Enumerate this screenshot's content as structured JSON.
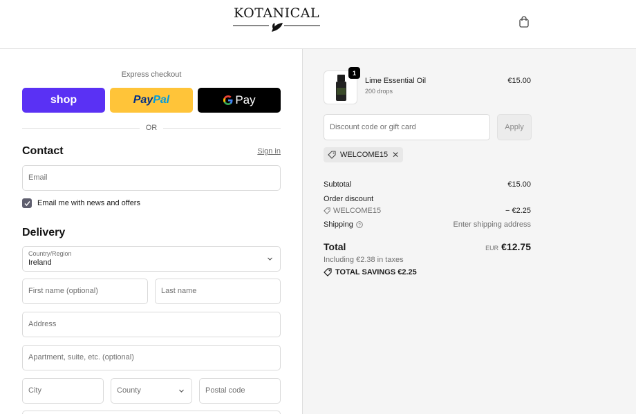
{
  "header": {
    "logo_text": "KOTANICAL",
    "cart_icon": "shopping-bag-icon"
  },
  "express": {
    "title": "Express checkout",
    "shop_label": "shop",
    "paypal_label_a": "Pay",
    "paypal_label_b": "Pal",
    "gpay_label": "Pay",
    "or_label": "OR"
  },
  "contact": {
    "title": "Contact",
    "signin_label": "Sign in",
    "email_placeholder": "Email",
    "news_checkbox_label": "Email me with news and offers",
    "news_checked": true
  },
  "delivery": {
    "title": "Delivery",
    "country_label": "Country/Region",
    "country_value": "Ireland",
    "first_name_placeholder": "First name (optional)",
    "last_name_placeholder": "Last name",
    "address_placeholder": "Address",
    "apartment_placeholder": "Apartment, suite, etc. (optional)",
    "city_placeholder": "City",
    "county_placeholder": "County",
    "postal_placeholder": "Postal code"
  },
  "summary": {
    "product": {
      "name": "Lime Essential Oil",
      "variant": "200 drops",
      "price": "€15.00",
      "quantity": "1"
    },
    "discount_placeholder": "Discount code or gift card",
    "apply_label": "Apply",
    "applied_code": "WELCOME15",
    "subtotal_label": "Subtotal",
    "subtotal_value": "€15.00",
    "order_discount_label": "Order discount",
    "order_discount_code": "WELCOME15",
    "order_discount_value": "− €2.25",
    "shipping_label": "Shipping",
    "shipping_value": "Enter shipping address",
    "total_label": "Total",
    "total_currency": "EUR",
    "total_value": "€12.75",
    "tax_line": "Including €2.38 in taxes",
    "savings_line": "TOTAL SAVINGS €2.25"
  },
  "colors": {
    "shop_purple": "#5a31f4",
    "paypal_yellow": "#ffc439",
    "gpay_black": "#000000",
    "summary_bg": "#f5f5f5"
  }
}
